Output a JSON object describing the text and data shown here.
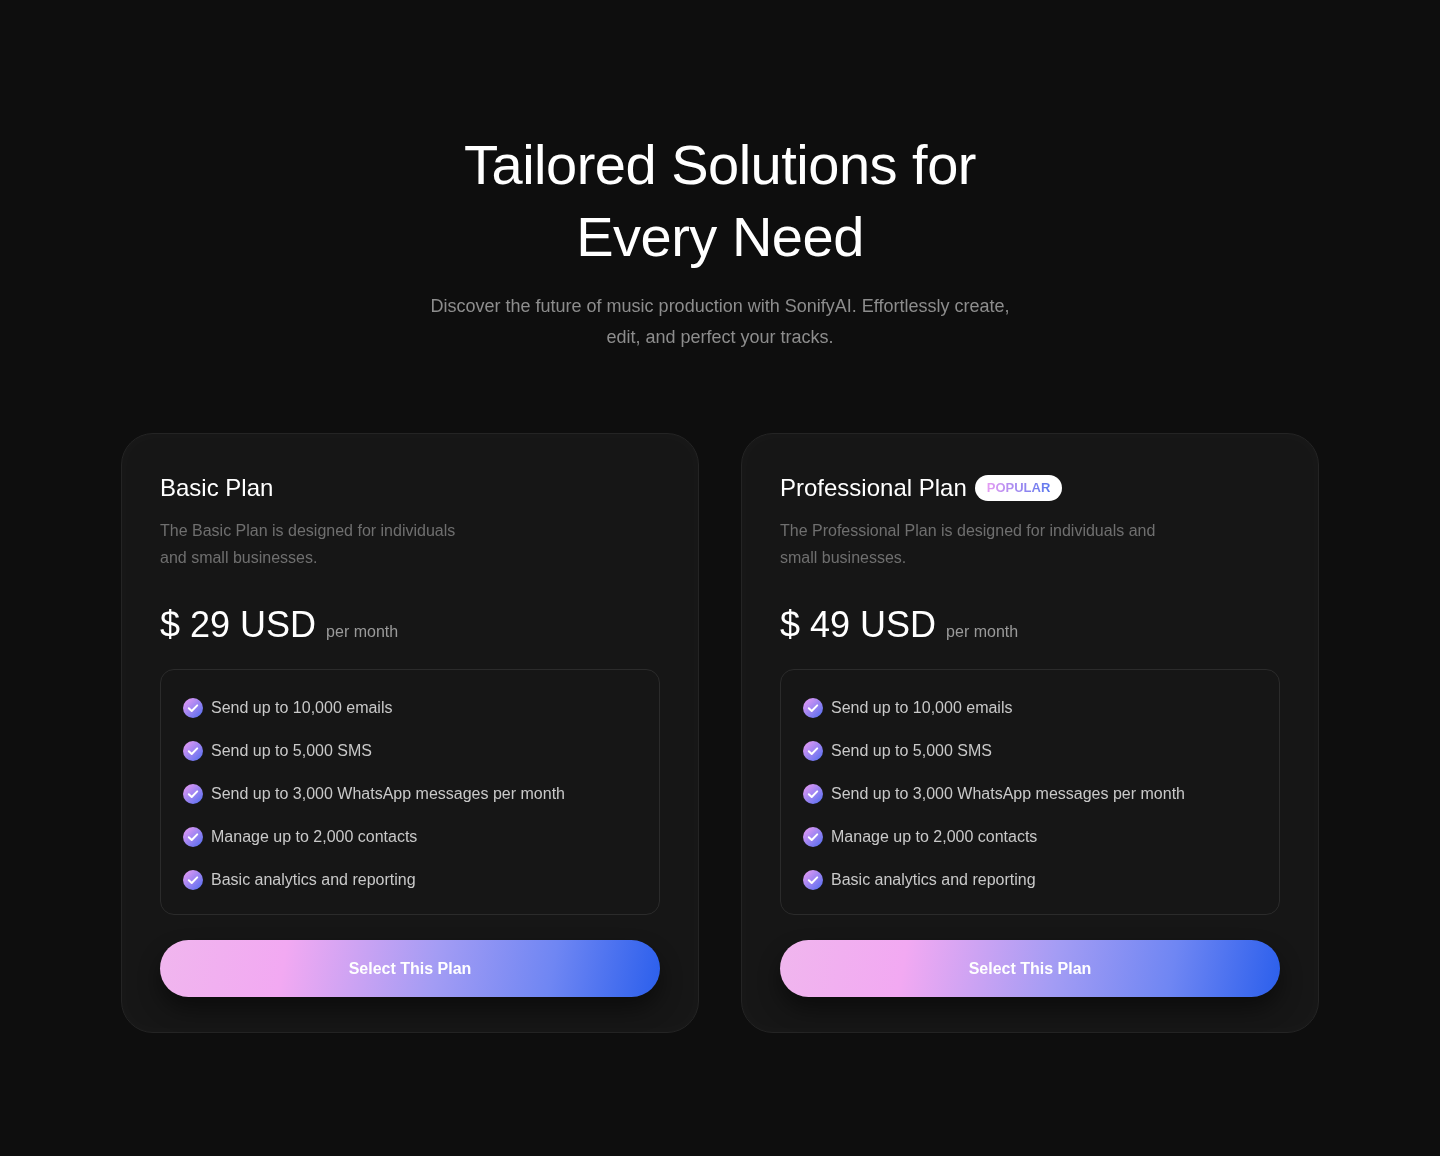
{
  "header": {
    "title": "Tailored Solutions for\nEvery Need",
    "subtitle": "Discover the future of music production with SonifyAI. Effortlessly create,\nedit, and perfect your tracks."
  },
  "plans": [
    {
      "name": "Basic Plan",
      "description": "The Basic Plan is designed for individuals\nand small businesses.",
      "price": "$ 29 USD",
      "period": "per month",
      "features": [
        "Send up to 10,000 emails",
        "Send up to 5,000 SMS",
        "Send up to 3,000 WhatsApp messages per month",
        "Manage up to 2,000 contacts",
        "Basic analytics and reporting"
      ],
      "button": "Select This Plan"
    },
    {
      "name": "Professional Plan",
      "badge": "POPULAR",
      "description": "The Professional Plan is designed for individuals and\nsmall businesses.",
      "price": "$ 49 USD",
      "period": "per month",
      "features": [
        "Send up to 10,000 emails",
        "Send up to 5,000 SMS",
        "Send up to 3,000 WhatsApp messages per month",
        "Manage up to 2,000 contacts",
        "Basic analytics and reporting"
      ],
      "button": "Select This Plan"
    }
  ]
}
